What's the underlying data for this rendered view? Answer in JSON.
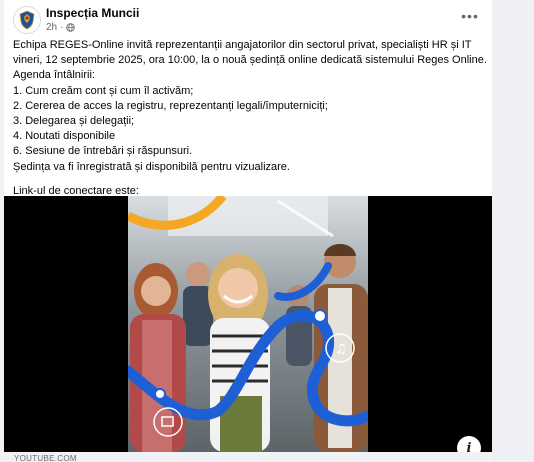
{
  "post": {
    "page_name": "Inspecția Muncii",
    "time": "2h",
    "privacy_icon": "globe-icon",
    "more_icon": "more-options-icon",
    "text_lines": [
      "Echipa REGES-Online invită reprezentanții angajatorilor din sectorul privat, specialiști HR și IT vineri, 12 septembrie 2025, ora 10:00, la o nouă ședință online dedicată sistemului Reges Online.",
      "Agenda întâlnirii:",
      "1. Cum creăm cont și cum îl activăm;",
      "2. Cererea de acces la registru, reprezentanți legali/împuterniciți;",
      "3. Delegarea și delegații;",
      "4. Noutati disponibile",
      "6. Sesiune de întrebări și răspunsuri.",
      "Ședința va fi înregistrată și disponibilă pentru vizualizare."
    ],
    "link_intro": "Link-ul de conectare este:"
  },
  "media": {
    "info_icon": "info-icon",
    "info_label": "i",
    "domain": "YOUTUBE.COM"
  },
  "colors": {
    "brand_blue": "#1e5fd6",
    "accent_orange": "#f5a623",
    "background": "#f0f2f5"
  }
}
